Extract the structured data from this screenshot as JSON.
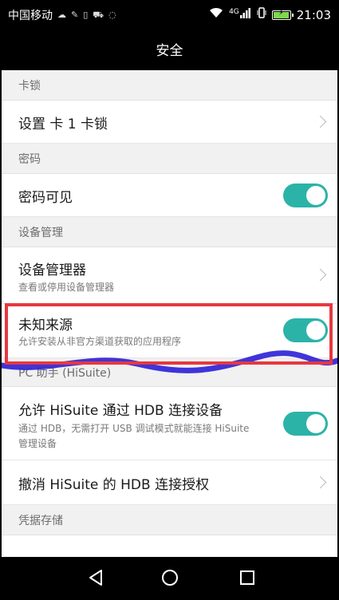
{
  "status_bar": {
    "carrier": "中国移动",
    "network": "4G",
    "time": "21:03",
    "icons": [
      "cloud-icon",
      "theme-icon",
      "sim-icon",
      "car-icon",
      "chat-icon",
      "wifi-icon",
      "signal-icon",
      "vibrate-icon",
      "battery-icon"
    ]
  },
  "title": "安全",
  "sections": {
    "card_lock": "卡锁",
    "password": "密码",
    "device_management": "设备管理",
    "pc_assistant": "PC 助手 (HiSuite)",
    "credential_storage": "凭据存储"
  },
  "rows": {
    "set_card_lock": {
      "title": "设置 卡 1 卡锁"
    },
    "password_visible": {
      "title": "密码可见",
      "enabled": true
    },
    "device_admin": {
      "title": "设备管理器",
      "subtitle": "查看或停用设备管理器"
    },
    "unknown_sources": {
      "title": "未知来源",
      "subtitle": "允许安装从非官方渠道获取的应用程序",
      "enabled": true
    },
    "hisuite_hdb": {
      "title": "允许 HiSuite 通过 HDB 连接设备",
      "subtitle_line1": "通过 HDB，无需打开 USB 调试模式就能连接 HiSuite",
      "subtitle_line2": "管理设备",
      "enabled": true
    },
    "revoke_hdb": {
      "title": "撤消 HiSuite 的 HDB 连接授权"
    }
  },
  "annotation": {
    "highlight_color": "#e8373f",
    "scribble_color": "#2a1fd6"
  },
  "colors": {
    "toggle_on": "#2bb3a8",
    "title_bar": "#000000"
  }
}
